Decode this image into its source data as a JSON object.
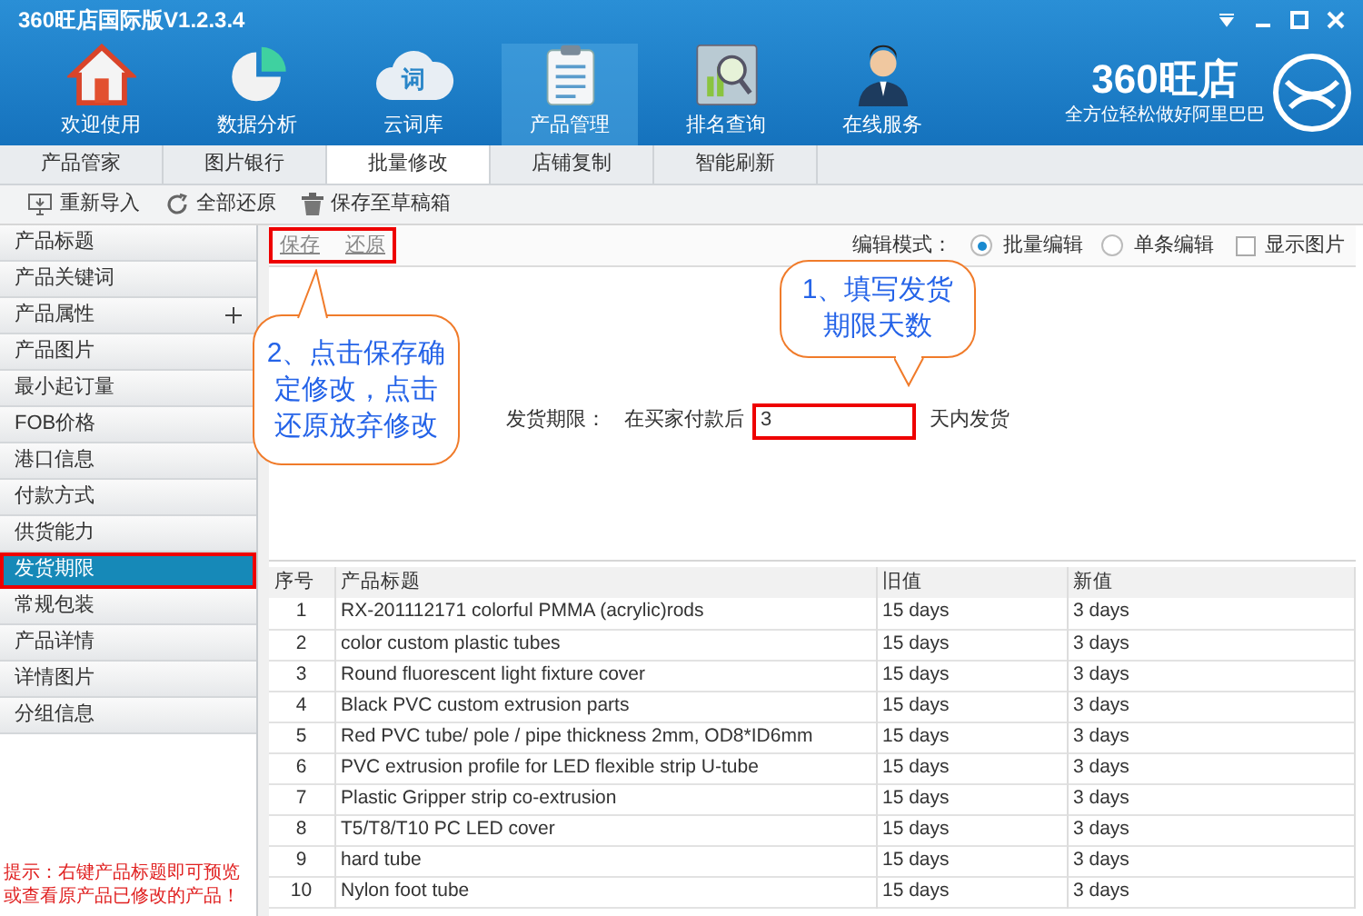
{
  "window": {
    "title": "360旺店国际版V1.2.3.4"
  },
  "nav": [
    {
      "label": "欢迎使用",
      "kind": "house",
      "selected": false
    },
    {
      "label": "数据分析",
      "kind": "pie",
      "selected": false
    },
    {
      "label": "云词库",
      "kind": "cloud",
      "icon_text": "词",
      "selected": false
    },
    {
      "label": "产品管理",
      "kind": "clipboard",
      "selected": true
    },
    {
      "label": "排名查询",
      "kind": "magnifier",
      "selected": false
    },
    {
      "label": "在线服务",
      "kind": "person",
      "selected": false
    }
  ],
  "logo": {
    "name": "360旺店",
    "slogan": "全方位轻松做好阿里巴巴"
  },
  "tabs": [
    {
      "label": "产品管家",
      "selected": false
    },
    {
      "label": "图片银行",
      "selected": false
    },
    {
      "label": "批量修改",
      "selected": true
    },
    {
      "label": "店铺复制",
      "selected": false
    },
    {
      "label": "智能刷新",
      "selected": false
    }
  ],
  "toolbar": [
    {
      "label": "重新导入",
      "kind": "import"
    },
    {
      "label": "全部还原",
      "kind": "restore"
    },
    {
      "label": "保存至草稿箱",
      "kind": "trash"
    }
  ],
  "sidebar": {
    "items": [
      {
        "label": "产品标题",
        "selected": false
      },
      {
        "label": "产品关键词",
        "selected": false
      },
      {
        "label": "产品属性",
        "selected": false,
        "expandable": true
      },
      {
        "label": "产品图片",
        "selected": false
      },
      {
        "label": "最小起订量",
        "selected": false
      },
      {
        "label": "FOB价格",
        "selected": false
      },
      {
        "label": "港口信息",
        "selected": false
      },
      {
        "label": "付款方式",
        "selected": false
      },
      {
        "label": "供货能力",
        "selected": false
      },
      {
        "label": "发货期限",
        "selected": true
      },
      {
        "label": "常规包装",
        "selected": false
      },
      {
        "label": "产品详情",
        "selected": false
      },
      {
        "label": "详情图片",
        "selected": false
      },
      {
        "label": "分组信息",
        "selected": false
      }
    ],
    "hint": "提示：右键产品标题即可预览或查看原产品已修改的产品！"
  },
  "actions": [
    "保存",
    "还原"
  ],
  "edit_mode": {
    "label": "编辑模式：",
    "options": [
      {
        "label": "批量编辑",
        "selected": true
      },
      {
        "label": "单条编辑",
        "selected": false
      }
    ],
    "show_images": {
      "label": "显示图片",
      "checked": false
    }
  },
  "form": {
    "label": "发货期限：",
    "prefix": "在买家付款后",
    "value": "3",
    "suffix": "天内发货"
  },
  "callouts": [
    {
      "text": "1、填写发货期限天数"
    },
    {
      "text": "2、点击保存确定修改，点击还原放弃修改"
    }
  ],
  "table": {
    "columns": [
      "序号",
      "产品标题",
      "旧值",
      "新值"
    ],
    "rows": [
      [
        "1",
        "RX-201112171 colorful PMMA (acrylic)rods",
        "15 days",
        "3 days"
      ],
      [
        "2",
        "color custom plastic tubes",
        "15 days",
        "3 days"
      ],
      [
        "3",
        "Round fluorescent light fixture cover",
        "15 days",
        "3 days"
      ],
      [
        "4",
        "Black PVC custom extrusion parts",
        "15 days",
        "3 days"
      ],
      [
        "5",
        "Red PVC tube/ pole / pipe thickness 2mm, OD8*ID6mm",
        "15 days",
        "3 days"
      ],
      [
        "6",
        "PVC extrusion profile for LED flexible strip U-tube",
        "15 days",
        "3 days"
      ],
      [
        "7",
        "Plastic Gripper strip co-extrusion",
        "15 days",
        "3 days"
      ],
      [
        "8",
        "T5/T8/T10 PC LED cover",
        "15 days",
        "3 days"
      ],
      [
        "9",
        "hard tube",
        "15 days",
        "3 days"
      ],
      [
        "10",
        "Nylon foot tube",
        "15 days",
        "3 days"
      ]
    ]
  }
}
